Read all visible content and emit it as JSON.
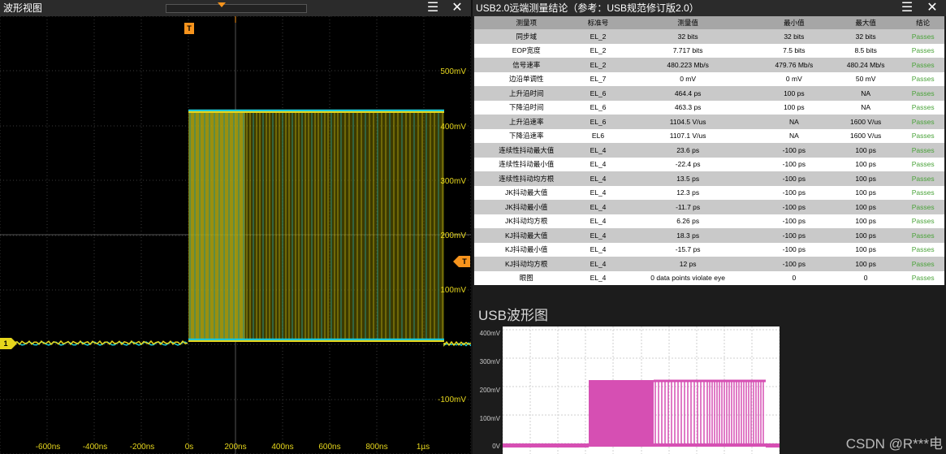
{
  "left_window": {
    "title": "波形视图",
    "menu_icon": "hamburger-menu-icon",
    "close_icon": "close-icon",
    "trigger_marker": "T",
    "channel_marker": "1",
    "trigger_level_marker": "T",
    "y_axis_labels": [
      "500mV",
      "400mV",
      "300mV",
      "200mV",
      "100mV",
      "-100mV"
    ],
    "x_axis_labels": [
      "-600ns",
      "-400ns",
      "-200ns",
      "0s",
      "200ns",
      "400ns",
      "600ns",
      "800ns",
      "1µs"
    ],
    "colors": {
      "channel1": "#e6d61c",
      "channel2": "#1fc8d4",
      "trigger": "#f7941d",
      "grid": "#3a3a3a"
    }
  },
  "right_window": {
    "title": "USB2.0远端测量结论（参考：USB规范修订版2.0）",
    "menu_icon": "hamburger-menu-icon",
    "close_icon": "close-icon",
    "table": {
      "headers": [
        "测量项",
        "标准号",
        "测量值",
        "最小值",
        "最大值",
        "结论"
      ],
      "rows": [
        [
          "同步域",
          "EL_2",
          "32 bits",
          "32 bits",
          "32 bits",
          "Passes"
        ],
        [
          "EOP宽度",
          "EL_2",
          "7.717 bits",
          "7.5 bits",
          "8.5 bits",
          "Passes"
        ],
        [
          "信号速率",
          "EL_2",
          "480.223 Mb/s",
          "479.76 Mb/s",
          "480.24 Mb/s",
          "Passes"
        ],
        [
          "边沿单调性",
          "EL_7",
          "0 mV",
          "0 mV",
          "50 mV",
          "Passes"
        ],
        [
          "上升沿时间",
          "EL_6",
          "464.4 ps",
          "100 ps",
          "NA",
          "Passes"
        ],
        [
          "下降沿时间",
          "EL_6",
          "463.3 ps",
          "100 ps",
          "NA",
          "Passes"
        ],
        [
          "上升沿速率",
          "EL_6",
          "1104.5 V/us",
          "NA",
          "1600 V/us",
          "Passes"
        ],
        [
          "下降沿速率",
          "EL6",
          "1107.1 V/us",
          "NA",
          "1600 V/us",
          "Passes"
        ],
        [
          "连续性抖动最大值",
          "EL_4",
          "23.6 ps",
          "-100 ps",
          "100 ps",
          "Passes"
        ],
        [
          "连续性抖动最小值",
          "EL_4",
          "-22.4 ps",
          "-100 ps",
          "100 ps",
          "Passes"
        ],
        [
          "连续性抖动均方根",
          "EL_4",
          "13.5 ps",
          "-100 ps",
          "100 ps",
          "Passes"
        ],
        [
          "JK抖动最大值",
          "EL_4",
          "12.3 ps",
          "-100 ps",
          "100 ps",
          "Passes"
        ],
        [
          "JK抖动最小值",
          "EL_4",
          "-11.7 ps",
          "-100 ps",
          "100 ps",
          "Passes"
        ],
        [
          "JK抖动均方根",
          "EL_4",
          "6.26 ps",
          "-100 ps",
          "100 ps",
          "Passes"
        ],
        [
          "KJ抖动最大值",
          "EL_4",
          "18.3 ps",
          "-100 ps",
          "100 ps",
          "Passes"
        ],
        [
          "KJ抖动最小值",
          "EL_4",
          "-15.7 ps",
          "-100 ps",
          "100 ps",
          "Passes"
        ],
        [
          "KJ抖动均方根",
          "EL_4",
          "12 ps",
          "-100 ps",
          "100 ps",
          "Passes"
        ],
        [
          "眼图",
          "EL_4",
          "0 data points violate eye",
          "0",
          "0",
          "Passes"
        ]
      ]
    },
    "waveform": {
      "title": "USB波形图",
      "y_axis_labels": [
        "400mV",
        "300mV",
        "200mV",
        "100mV",
        "0V"
      ],
      "color": "#d64fb3"
    }
  },
  "watermark": "CSDN @R***电"
}
